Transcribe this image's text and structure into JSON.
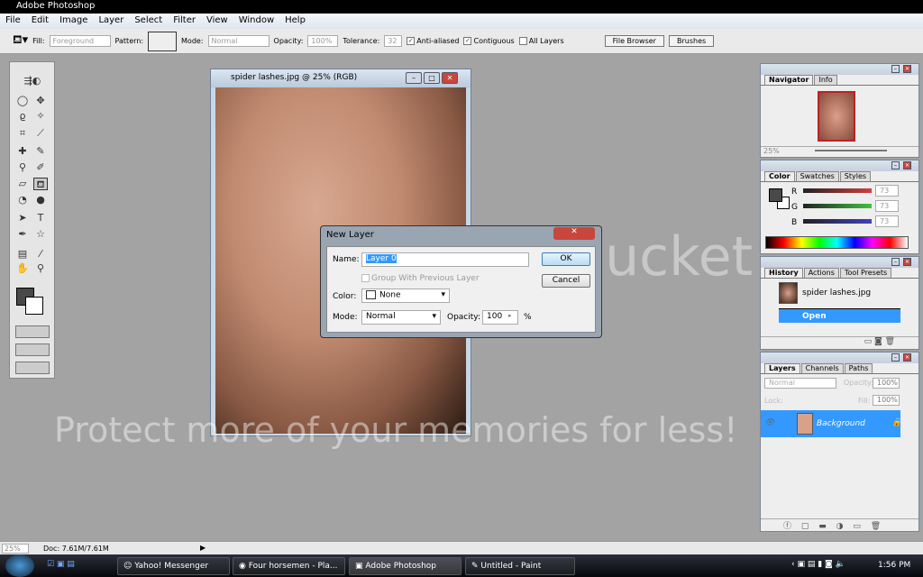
{
  "app": {
    "title": "Adobe Photoshop"
  },
  "menu": [
    "File",
    "Edit",
    "Image",
    "Layer",
    "Select",
    "Filter",
    "View",
    "Window",
    "Help"
  ],
  "options": {
    "fill_label": "Fill:",
    "fill_value": "Foreground",
    "pattern_label": "Pattern:",
    "mode_label": "Mode:",
    "mode_value": "Normal",
    "opacity_label": "Opacity:",
    "opacity_value": "100%",
    "tolerance_label": "Tolerance:",
    "tolerance_value": "32",
    "anti_aliased": "Anti-aliased",
    "contiguous": "Contiguous",
    "all_layers": "All Layers",
    "tab_file_browser": "File Browser",
    "tab_brushes": "Brushes"
  },
  "document": {
    "title": "spider lashes.jpg @ 25% (RGB)"
  },
  "dialog": {
    "title": "New Layer",
    "name_label": "Name:",
    "name_value": "Layer 0",
    "group_label": "Group With Previous Layer",
    "color_label": "Color:",
    "color_value": "None",
    "mode_label": "Mode:",
    "mode_value": "Normal",
    "opacity_label": "Opacity:",
    "opacity_value": "100",
    "percent": "%",
    "ok": "OK",
    "cancel": "Cancel"
  },
  "navigator": {
    "tabs": [
      "Navigator",
      "Info"
    ],
    "zoom": "25%"
  },
  "color": {
    "tabs": [
      "Color",
      "Swatches",
      "Styles"
    ],
    "r_label": "R",
    "g_label": "G",
    "b_label": "B",
    "r": "73",
    "g": "73",
    "b": "73",
    "foreground": "#494949"
  },
  "history": {
    "tabs": [
      "History",
      "Actions",
      "Tool Presets"
    ],
    "snapshot": "spider lashes.jpg",
    "item": "Open"
  },
  "layers": {
    "tabs": [
      "Layers",
      "Channels",
      "Paths"
    ],
    "mode": "Normal",
    "opacity_label": "Opacity:",
    "opacity": "100%",
    "lock_label": "Lock:",
    "fill_label": "Fill:",
    "fill": "100%",
    "layer_name": "Background"
  },
  "status": {
    "zoom": "25%",
    "doc": "Doc: 7.61M/7.61M"
  },
  "taskbar": {
    "items": [
      "Yahoo! Messenger",
      "Four horsemen - Pla...",
      "Adobe Photoshop",
      "Untitled - Paint"
    ],
    "clock": "1:56 PM"
  },
  "watermark": {
    "line1": "Protect more of your memories for less!",
    "brand": "photobucket"
  },
  "colors": {
    "selection": "#3399ff",
    "workspace": "#a3a3a3"
  }
}
